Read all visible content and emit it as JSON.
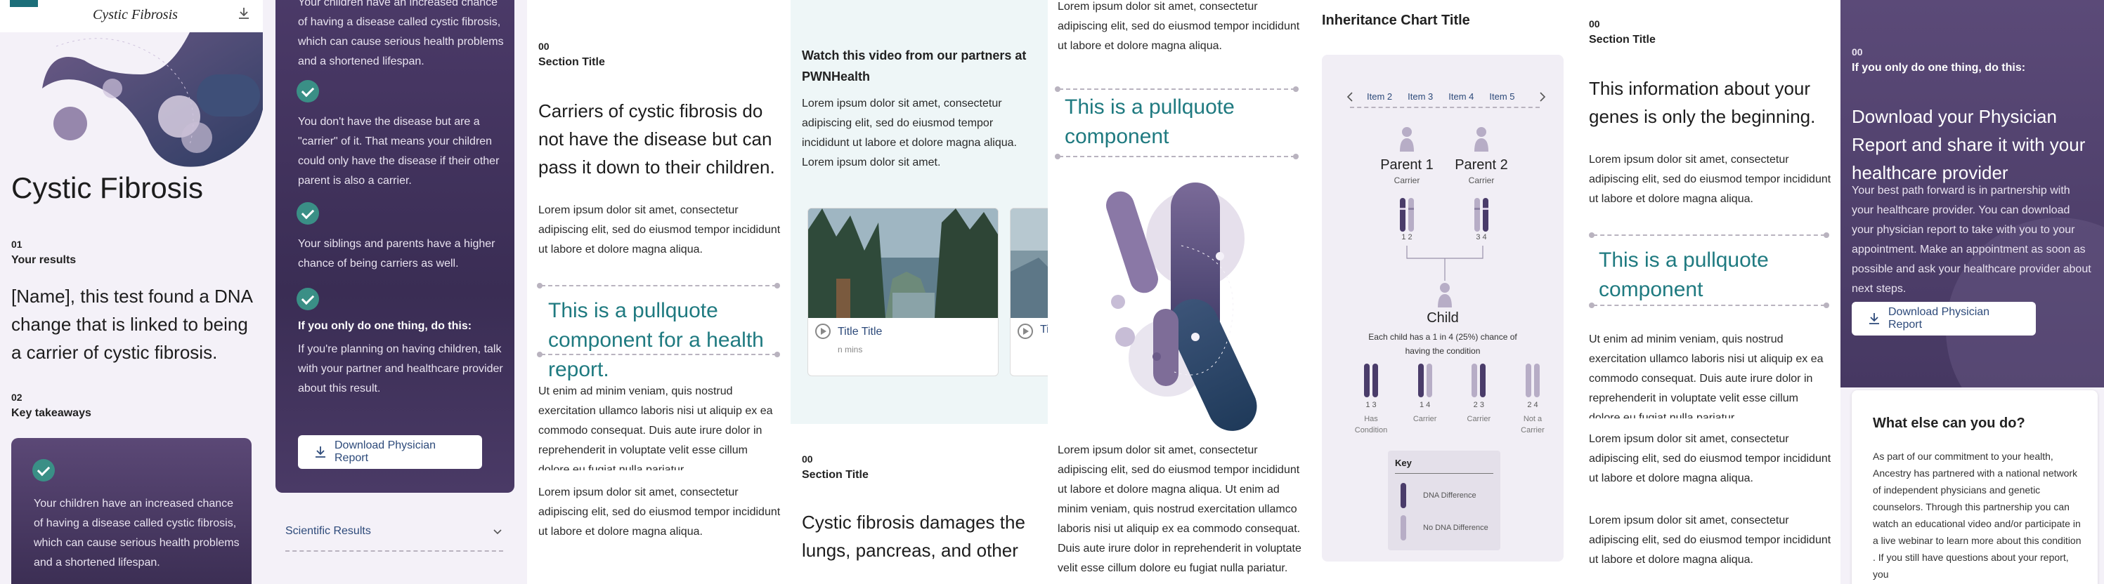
{
  "panel1": {
    "logo_text": "Cystic Fibrosis",
    "page_title": "Cystic Fibrosis",
    "section1_num": "01",
    "section1_title": "Your results",
    "result_text": "[Name], this test found a DNA change that is linked to being a carrier of cystic fibrosis.",
    "section2_num": "02",
    "section2_title": "Key takeaways",
    "takeaway1": "Your children have an increased chance of having a disease called cystic fibrosis, which can cause serious health problems and a shortened lifespan."
  },
  "panel2": {
    "takeaway1_cont": "Your children have an increased chance of having a disease called cystic fibrosis, which can cause serious health problems and a shortened lifespan.",
    "takeaway2": "You don't have the disease but are a \"carrier\" of it. That means your children could only have the disease if their other parent is also a carrier.",
    "takeaway3": "Your siblings and parents have a higher chance of being carriers as well.",
    "takeaway4_title": "If you only do one thing, do this:",
    "takeaway4": "If you're planning on having children, talk with your partner and healthcare provider about this result.",
    "download_label": "Download Physician Report",
    "accordion_label": "Scientific Results"
  },
  "panel3": {
    "num": "00",
    "title": "Section Title",
    "lead": "Carriers of cystic fibrosis do not have the disease but can pass it down to their children.",
    "para1": "Lorem ipsum dolor sit amet, consectetur adipiscing elit, sed do eiusmod tempor incididunt ut labore et dolore magna aliqua.",
    "pullquote": "This is a pullquote component for a health report.",
    "para2": "Ut enim ad minim veniam, quis nostrud exercitation ullamco laboris nisi ut aliquip ex ea commodo consequat. Duis aute irure dolor in reprehenderit in voluptate velit esse cillum dolore eu fugiat nulla pariatur.",
    "para3": "Lorem ipsum dolor sit amet, consectetur adipiscing elit, sed do eiusmod tempor incididunt ut labore et dolore magna aliqua."
  },
  "panel4": {
    "video_heading": "Watch this video from our partners at PWNHealth",
    "video_text": "Lorem ipsum dolor sit amet, consectetur adipiscing elit, sed do eiusmod tempor incididunt ut labore et dolore magna aliqua. Lorem ipsum dolor sit amet.",
    "card1_title": "Title Title",
    "card1_meta": "n mins",
    "card2_title": "Title",
    "num": "00",
    "title": "Section Title",
    "lead": "Cystic fibrosis damages the lungs, pancreas, and other"
  },
  "panel5": {
    "para_top": "Lorem ipsum dolor sit amet, consectetur adipiscing elit, sed do eiusmod tempor incididunt ut labore et dolore magna aliqua.",
    "pullquote": "This is a pullquote component",
    "para_bottom": "Lorem ipsum dolor sit amet, consectetur adipiscing elit, sed do eiusmod tempor incididunt ut labore et dolore magna aliqua. Ut enim ad minim veniam, quis nostrud exercitation ullamco laboris nisi ut aliquip ex ea commodo consequat. Duis aute irure dolor in reprehenderit in voluptate velit esse cillum dolore eu fugiat nulla pariatur."
  },
  "panel6": {
    "chart_title": "Inheritance Chart Title",
    "tabs": [
      "Item 2",
      "Item 3",
      "Item 4",
      "Item 5"
    ],
    "parent1_name": "Parent 1",
    "parent1_role": "Carrier",
    "parent1_alleles": "1 2",
    "parent2_name": "Parent 2",
    "parent2_role": "Carrier",
    "parent2_alleles": "3 4",
    "child_name": "Child",
    "child_note": "Each child has a 1 in 4 (25%) chance of having the condition",
    "children": [
      {
        "alleles": "1 3",
        "label": "Has Condition"
      },
      {
        "alleles": "1 4",
        "label": "Carrier"
      },
      {
        "alleles": "2 3",
        "label": "Carrier"
      },
      {
        "alleles": "2 4",
        "label": "Not a Carrier"
      }
    ],
    "key_title": "Key",
    "key_dna_diff": "DNA Difference",
    "key_no_dna_diff": "No DNA Difference"
  },
  "panel7": {
    "num": "00",
    "title": "Section Title",
    "lead": "This information about your genes is only the beginning.",
    "para1": "Lorem ipsum dolor sit amet, consectetur adipiscing elit, sed do eiusmod tempor incididunt ut labore et dolore magna aliqua.",
    "pullquote": "This is a pullquote component",
    "para2": "Ut enim ad minim veniam, quis nostrud exercitation ullamco laboris nisi ut aliquip ex ea commodo consequat. Duis aute irure dolor in reprehenderit in voluptate velit esse cillum dolore eu fugiat nulla pariatur.",
    "para3": "Lorem ipsum dolor sit amet, consectetur adipiscing elit, sed do eiusmod tempor incididunt ut labore et dolore magna aliqua.",
    "para4": "Lorem ipsum dolor sit amet, consectetur adipiscing elit, sed do eiusmod tempor incididunt ut labore et dolore magna aliqua."
  },
  "panel8": {
    "num": "00",
    "eyebrow": "If you only do one thing, do this:",
    "heading": "Download your Physician Report and share it with your healthcare provider",
    "text": "Your best path forward is in partnership with your healthcare provider. You can download your physician report to take with you to your appointment. Make an appointment as soon as possible and ask your healthcare provider about next steps.",
    "download_label": "Download Physician Report",
    "card_title": "What else can you do?",
    "card_text": "As part of our commitment to your health, Ancestry has partnered with a national network of independent physicians and genetic counselors. Through this partnership you can watch an  educational video and/or participate in a live webinar to learn more about this condition . If you still have questions about your report, you"
  }
}
